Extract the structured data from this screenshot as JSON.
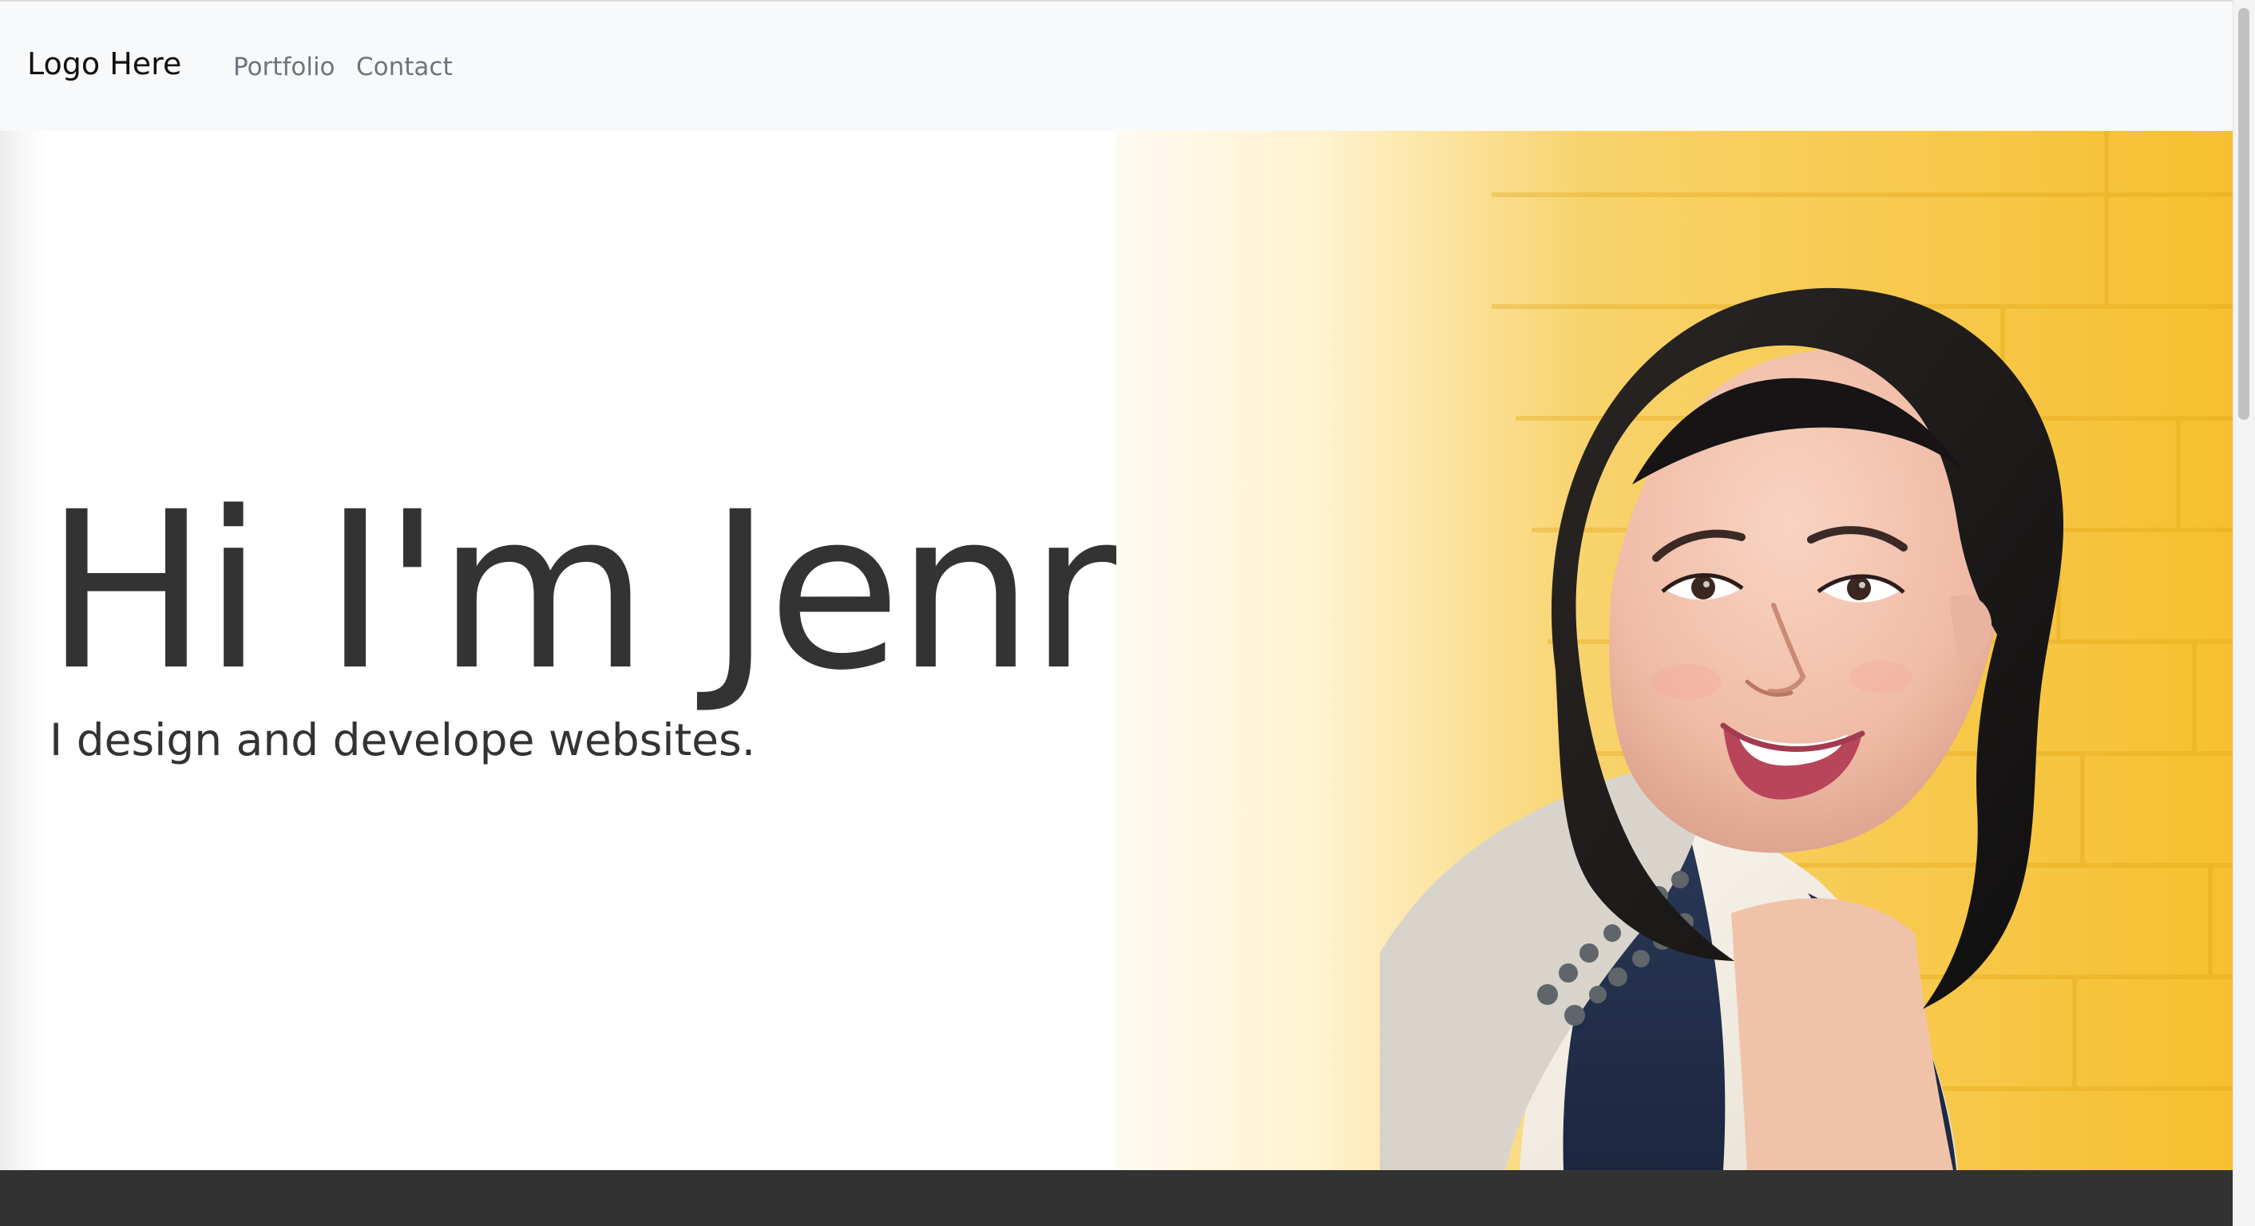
{
  "navbar": {
    "brand": "Logo Here",
    "links": [
      "Portfolio",
      "Contact"
    ]
  },
  "hero": {
    "title": "Hi I'm Jenn",
    "subtitle": "I design and develope websites.",
    "photo_alt": "Portrait of Jenn smiling in front of a yellow brick wall"
  },
  "colors": {
    "navbar_bg": "#f8f9fa",
    "text_dark": "#333333",
    "nav_link": "#6c757d",
    "wall_yellow": "#f7c843",
    "footer": "#323232"
  }
}
